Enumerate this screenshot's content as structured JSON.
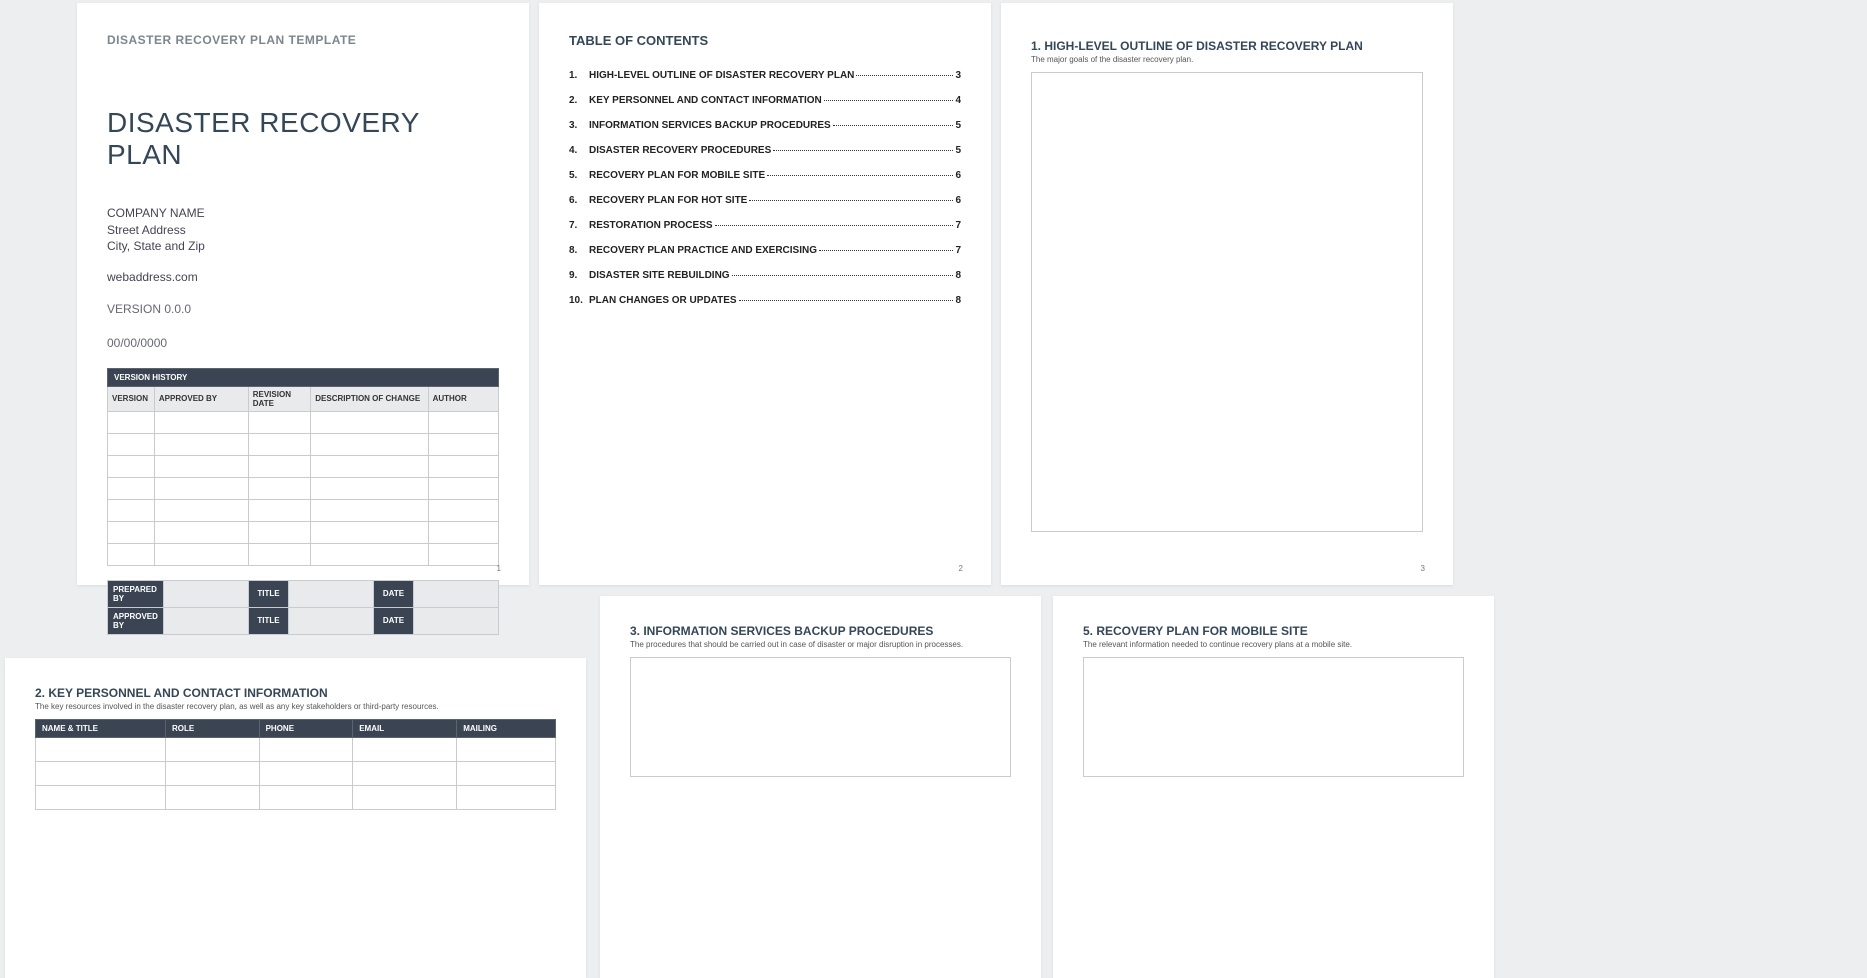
{
  "page1": {
    "template_label": "DISASTER RECOVERY PLAN TEMPLATE",
    "title": "DISASTER RECOVERY PLAN",
    "company": "COMPANY NAME",
    "street": "Street Address",
    "city": "City, State and Zip",
    "web": "webaddress.com",
    "version": "VERSION 0.0.0",
    "date": "00/00/0000",
    "vh_header": "VERSION HISTORY",
    "vh_cols": [
      "VERSION",
      "APPROVED BY",
      "REVISION DATE",
      "DESCRIPTION OF CHANGE",
      "AUTHOR"
    ],
    "prep": {
      "prepared_by": "PREPARED BY",
      "title": "TITLE",
      "date": "DATE",
      "approved_by": "APPROVED BY"
    },
    "page_num": "1"
  },
  "page2": {
    "title": "TABLE OF CONTENTS",
    "items": [
      {
        "n": "1.",
        "t": "HIGH-LEVEL OUTLINE OF DISASTER RECOVERY PLAN",
        "p": "3"
      },
      {
        "n": "2.",
        "t": "KEY PERSONNEL AND CONTACT INFORMATION",
        "p": "4"
      },
      {
        "n": "3.",
        "t": "INFORMATION SERVICES BACKUP PROCEDURES",
        "p": "5"
      },
      {
        "n": "4.",
        "t": "DISASTER RECOVERY PROCEDURES",
        "p": "5"
      },
      {
        "n": "5.",
        "t": "RECOVERY PLAN FOR MOBILE SITE",
        "p": "6"
      },
      {
        "n": "6.",
        "t": "RECOVERY PLAN FOR HOT SITE",
        "p": "6"
      },
      {
        "n": "7.",
        "t": "RESTORATION PROCESS",
        "p": "7"
      },
      {
        "n": "8.",
        "t": "RECOVERY PLAN PRACTICE AND EXERCISING",
        "p": "7"
      },
      {
        "n": "9.",
        "t": "DISASTER SITE REBUILDING",
        "p": "8"
      },
      {
        "n": "10.",
        "t": "PLAN CHANGES OR UPDATES",
        "p": "8"
      }
    ],
    "page_num": "2"
  },
  "page3": {
    "heading": "1.  HIGH-LEVEL OUTLINE OF DISASTER RECOVERY PLAN",
    "sub": "The major goals of the disaster recovery plan.",
    "page_num": "3"
  },
  "page4": {
    "heading": "2.  KEY PERSONNEL AND CONTACT INFORMATION",
    "sub": "The key resources involved in the disaster recovery plan, as well as any key stakeholders or third-party resources.",
    "cols": [
      "NAME & TITLE",
      "ROLE",
      "PHONE",
      "EMAIL",
      "MAILING"
    ]
  },
  "page5": {
    "heading": "3.  INFORMATION SERVICES BACKUP PROCEDURES",
    "sub": "The procedures that should be carried out in case of disaster or major disruption in processes."
  },
  "page6": {
    "heading": "5.  RECOVERY PLAN FOR MOBILE SITE",
    "sub": "The relevant information needed to continue recovery plans at a mobile site."
  }
}
